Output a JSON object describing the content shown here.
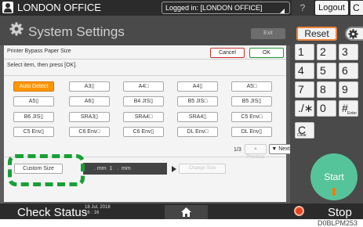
{
  "top_bar": {
    "user_icon": "user-icon",
    "office": "LONDON OFFICE",
    "logged_in": "Logged in: [LONDON OFFICE]",
    "help": "?",
    "logout": "Logout",
    "edge": "C"
  },
  "header": {
    "icon": "gear-icon",
    "title": "System Settings",
    "exit": "Exit"
  },
  "dialog": {
    "title": "Printer Bypass Paper Size",
    "cancel": "Cancel",
    "ok": "OK",
    "instruction": "Select item, then press [OK].",
    "paper_sizes": [
      "Auto Detect",
      "A3▯",
      "A4□",
      "A4▯",
      "A5□",
      "A5▯",
      "A6▯",
      "B4 JIS▯",
      "B5 JIS□",
      "B5 JIS▯",
      "B6 JIS▯",
      "SRA3▯",
      "SRA4□",
      "SRA4▯",
      "C5 Env□",
      "C5 Env▯",
      "C6 Env□",
      "C6 Env▯",
      "DL Env□",
      "DL Env▯"
    ],
    "selected": "Auto Detect",
    "page_indicator": "1/3",
    "prev": "▲ Previous",
    "next": "▼ Next",
    "custom_size": "Custom Size",
    "size_display": ". mm  1   .  mm",
    "change_size": "Change Size"
  },
  "right_panel": {
    "reset": "Reset",
    "settings_icon": "gear-icon",
    "keys": [
      {
        "label": "1",
        "sub": ""
      },
      {
        "label": "2",
        "sub": ""
      },
      {
        "label": "3",
        "sub": ""
      },
      {
        "label": "4",
        "sub": ""
      },
      {
        "label": "5",
        "sub": ""
      },
      {
        "label": "6",
        "sub": ""
      },
      {
        "label": "7",
        "sub": ""
      },
      {
        "label": "8",
        "sub": ""
      },
      {
        "label": "9",
        "sub": ""
      },
      {
        "label": "./∗",
        "sub": ""
      },
      {
        "label": "0",
        "sub": ""
      },
      {
        "label": "#",
        "sub": "Enter"
      },
      {
        "label": "C",
        "sub": "Clear"
      }
    ],
    "start": "Start"
  },
  "bottom_bar": {
    "check_status": "Check Status",
    "date": "18 Jul. 2018\n16 : 16",
    "home_icon": "home-icon",
    "stop_icon": "stop-icon",
    "stop": "Stop"
  },
  "image_code": "D0BLPM253",
  "colors": {
    "selected": "#ff9500",
    "callout": "#17a035",
    "start": "#56c49a",
    "reset_border": "#f0823a",
    "stop": "#e8431f"
  }
}
